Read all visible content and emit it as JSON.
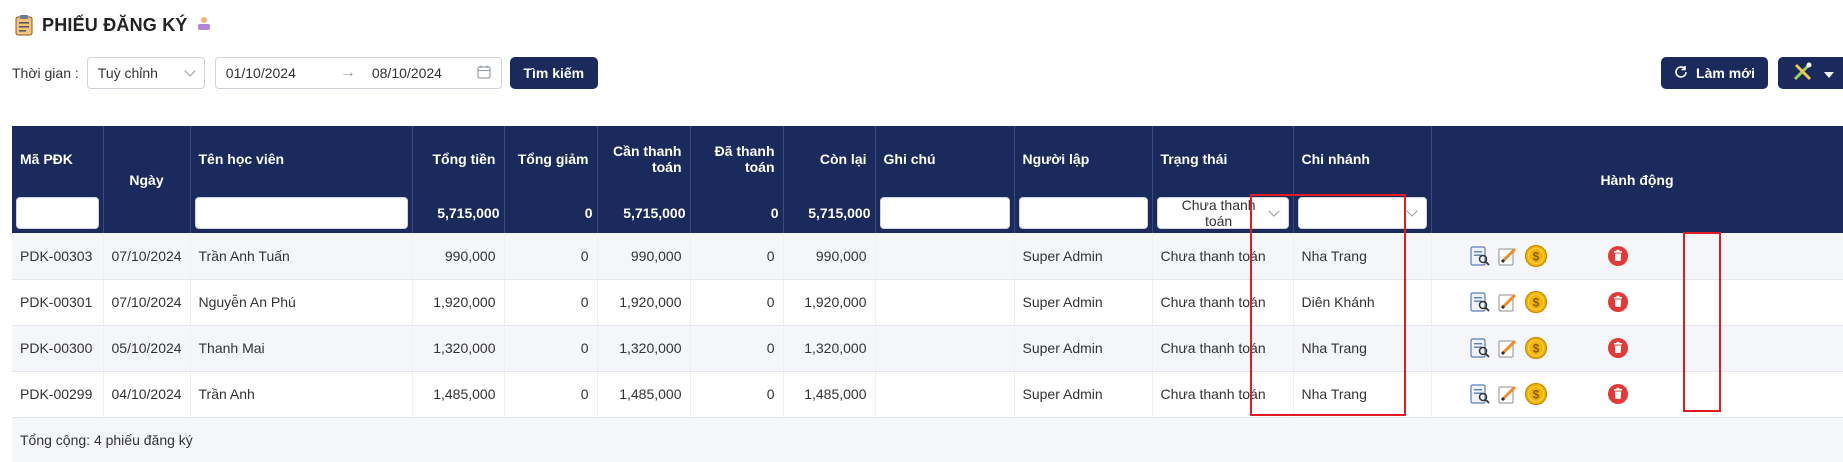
{
  "header": {
    "title": "PHIẾU ĐĂNG KÝ",
    "icon": "clipboard-icon",
    "badge_icon": "user-badge-icon"
  },
  "filters": {
    "time_label": "Thời gian :",
    "period_value": "Tuỳ chỉnh",
    "date_from": "01/10/2024",
    "date_to": "08/10/2024",
    "search_label": "Tìm kiếm"
  },
  "toolbar": {
    "refresh_label": "Làm mới",
    "tools_icon": "tools-icon"
  },
  "table": {
    "columns": {
      "code": "Mã PĐK",
      "date": "Ngày",
      "student": "Tên học viên",
      "total": "Tổng tiền",
      "discount": "Tổng giảm",
      "to_pay": "Cần thanh toán",
      "paid": "Đã thanh toán",
      "remaining": "Còn lại",
      "note": "Ghi chú",
      "creator": "Người lập",
      "status": "Trạng thái",
      "branch": "Chi nhánh",
      "actions": "Hành động"
    },
    "totals": {
      "total": "5,715,000",
      "discount": "0",
      "to_pay": "5,715,000",
      "paid": "0",
      "remaining": "5,715,000"
    },
    "status_filter": "Chưa thanh toán",
    "rows": [
      {
        "code": "PDK-00303",
        "date": "07/10/2024",
        "student": "Trần Anh Tuấn",
        "total": "990,000",
        "discount": "0",
        "to_pay": "990,000",
        "paid": "0",
        "remaining": "990,000",
        "note": "",
        "creator": "Super Admin",
        "status": "Chưa thanh toán",
        "branch": "Nha Trang"
      },
      {
        "code": "PDK-00301",
        "date": "07/10/2024",
        "student": "Nguyễn An Phú",
        "total": "1,920,000",
        "discount": "0",
        "to_pay": "1,920,000",
        "paid": "0",
        "remaining": "1,920,000",
        "note": "",
        "creator": "Super Admin",
        "status": "Chưa thanh toán",
        "branch": "Diên Khánh"
      },
      {
        "code": "PDK-00300",
        "date": "05/10/2024",
        "student": "Thanh Mai",
        "total": "1,320,000",
        "discount": "0",
        "to_pay": "1,320,000",
        "paid": "0",
        "remaining": "1,320,000",
        "note": "",
        "creator": "Super Admin",
        "status": "Chưa thanh toán",
        "branch": "Nha Trang"
      },
      {
        "code": "PDK-00299",
        "date": "04/10/2024",
        "student": "Trần Anh",
        "total": "1,485,000",
        "discount": "0",
        "to_pay": "1,485,000",
        "paid": "0",
        "remaining": "1,485,000",
        "note": "",
        "creator": "Super Admin",
        "status": "Chưa thanh toán",
        "branch": "Nha Trang"
      }
    ],
    "footer": "Tổng cộng: 4 phiếu đăng ký"
  },
  "colors": {
    "header_bg": "#1b2a5c",
    "highlight": "#e01b24",
    "coin": "#f5b400",
    "delete": "#e53935"
  }
}
